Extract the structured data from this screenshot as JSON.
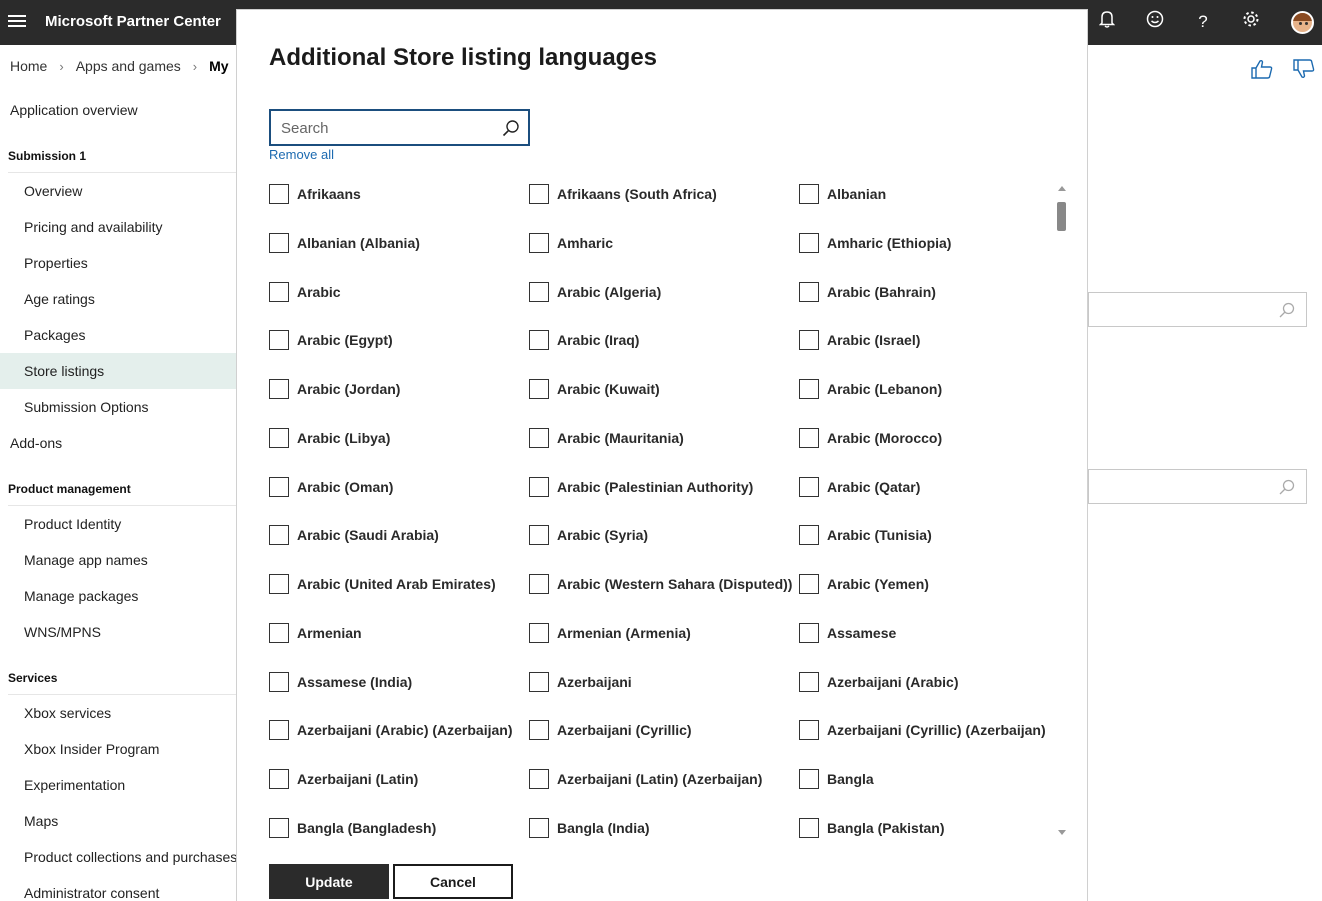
{
  "header": {
    "app_title": "Microsoft Partner Center",
    "icons": [
      "hamburger-menu-icon",
      "bell-icon",
      "smiley-icon",
      "help-icon",
      "gear-icon",
      "avatar"
    ]
  },
  "breadcrumb": {
    "items": [
      "Home",
      "Apps and games",
      "My"
    ]
  },
  "sidebar": {
    "application_overview": "Application overview",
    "submission_heading": "Submission 1",
    "submission_items": [
      "Overview",
      "Pricing and availability",
      "Properties",
      "Age ratings",
      "Packages",
      "Store listings",
      "Submission Options"
    ],
    "add_ons": "Add-ons",
    "product_management_heading": "Product management",
    "product_management_items": [
      "Product Identity",
      "Manage app names",
      "Manage packages",
      "WNS/MPNS"
    ],
    "services_heading": "Services",
    "services_items": [
      "Xbox services",
      "Xbox Insider Program",
      "Experimentation",
      "Maps",
      "Product collections and purchases",
      "Administrator consent"
    ],
    "active_item": "Store listings"
  },
  "modal": {
    "title": "Additional Store listing languages",
    "search_placeholder": "Search",
    "remove_all": "Remove all",
    "update_label": "Update",
    "cancel_label": "Cancel",
    "languages": [
      "Afrikaans",
      "Afrikaans (South Africa)",
      "Albanian",
      "Albanian (Albania)",
      "Amharic",
      "Amharic (Ethiopia)",
      "Arabic",
      "Arabic (Algeria)",
      "Arabic (Bahrain)",
      "Arabic (Egypt)",
      "Arabic (Iraq)",
      "Arabic (Israel)",
      "Arabic (Jordan)",
      "Arabic (Kuwait)",
      "Arabic (Lebanon)",
      "Arabic (Libya)",
      "Arabic (Mauritania)",
      "Arabic (Morocco)",
      "Arabic (Oman)",
      "Arabic (Palestinian Authority)",
      "Arabic (Qatar)",
      "Arabic (Saudi Arabia)",
      "Arabic (Syria)",
      "Arabic (Tunisia)",
      "Arabic (United Arab Emirates)",
      "Arabic (Western Sahara (Disputed))",
      "Arabic (Yemen)",
      "Armenian",
      "Armenian (Armenia)",
      "Assamese",
      "Assamese (India)",
      "Azerbaijani",
      "Azerbaijani (Arabic)",
      "Azerbaijani (Arabic) (Azerbaijan)",
      "Azerbaijani (Cyrillic)",
      "Azerbaijani (Cyrillic) (Azerbaijan)",
      "Azerbaijani (Latin)",
      "Azerbaijani (Latin) (Azerbaijan)",
      "Bangla",
      "Bangla (Bangladesh)",
      "Bangla (India)",
      "Bangla (Pakistan)"
    ]
  }
}
